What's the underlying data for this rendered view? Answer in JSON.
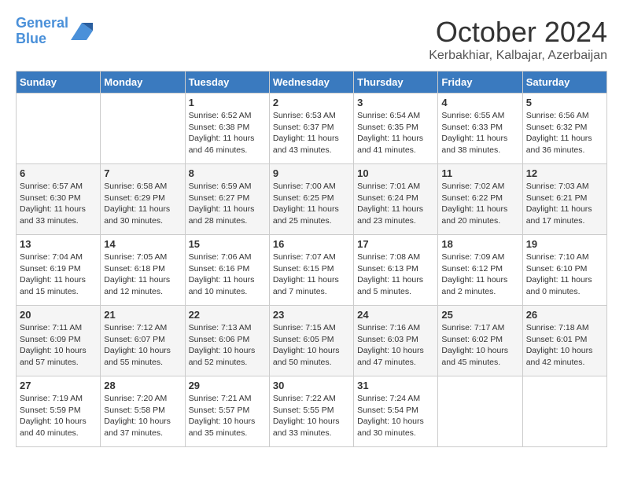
{
  "logo": {
    "line1": "General",
    "line2": "Blue"
  },
  "header": {
    "month": "October 2024",
    "location": "Kerbakhiar, Kalbajar, Azerbaijan"
  },
  "weekdays": [
    "Sunday",
    "Monday",
    "Tuesday",
    "Wednesday",
    "Thursday",
    "Friday",
    "Saturday"
  ],
  "weeks": [
    [
      {
        "day": "",
        "sunrise": "",
        "sunset": "",
        "daylight": ""
      },
      {
        "day": "",
        "sunrise": "",
        "sunset": "",
        "daylight": ""
      },
      {
        "day": "1",
        "sunrise": "Sunrise: 6:52 AM",
        "sunset": "Sunset: 6:38 PM",
        "daylight": "Daylight: 11 hours and 46 minutes."
      },
      {
        "day": "2",
        "sunrise": "Sunrise: 6:53 AM",
        "sunset": "Sunset: 6:37 PM",
        "daylight": "Daylight: 11 hours and 43 minutes."
      },
      {
        "day": "3",
        "sunrise": "Sunrise: 6:54 AM",
        "sunset": "Sunset: 6:35 PM",
        "daylight": "Daylight: 11 hours and 41 minutes."
      },
      {
        "day": "4",
        "sunrise": "Sunrise: 6:55 AM",
        "sunset": "Sunset: 6:33 PM",
        "daylight": "Daylight: 11 hours and 38 minutes."
      },
      {
        "day": "5",
        "sunrise": "Sunrise: 6:56 AM",
        "sunset": "Sunset: 6:32 PM",
        "daylight": "Daylight: 11 hours and 36 minutes."
      }
    ],
    [
      {
        "day": "6",
        "sunrise": "Sunrise: 6:57 AM",
        "sunset": "Sunset: 6:30 PM",
        "daylight": "Daylight: 11 hours and 33 minutes."
      },
      {
        "day": "7",
        "sunrise": "Sunrise: 6:58 AM",
        "sunset": "Sunset: 6:29 PM",
        "daylight": "Daylight: 11 hours and 30 minutes."
      },
      {
        "day": "8",
        "sunrise": "Sunrise: 6:59 AM",
        "sunset": "Sunset: 6:27 PM",
        "daylight": "Daylight: 11 hours and 28 minutes."
      },
      {
        "day": "9",
        "sunrise": "Sunrise: 7:00 AM",
        "sunset": "Sunset: 6:25 PM",
        "daylight": "Daylight: 11 hours and 25 minutes."
      },
      {
        "day": "10",
        "sunrise": "Sunrise: 7:01 AM",
        "sunset": "Sunset: 6:24 PM",
        "daylight": "Daylight: 11 hours and 23 minutes."
      },
      {
        "day": "11",
        "sunrise": "Sunrise: 7:02 AM",
        "sunset": "Sunset: 6:22 PM",
        "daylight": "Daylight: 11 hours and 20 minutes."
      },
      {
        "day": "12",
        "sunrise": "Sunrise: 7:03 AM",
        "sunset": "Sunset: 6:21 PM",
        "daylight": "Daylight: 11 hours and 17 minutes."
      }
    ],
    [
      {
        "day": "13",
        "sunrise": "Sunrise: 7:04 AM",
        "sunset": "Sunset: 6:19 PM",
        "daylight": "Daylight: 11 hours and 15 minutes."
      },
      {
        "day": "14",
        "sunrise": "Sunrise: 7:05 AM",
        "sunset": "Sunset: 6:18 PM",
        "daylight": "Daylight: 11 hours and 12 minutes."
      },
      {
        "day": "15",
        "sunrise": "Sunrise: 7:06 AM",
        "sunset": "Sunset: 6:16 PM",
        "daylight": "Daylight: 11 hours and 10 minutes."
      },
      {
        "day": "16",
        "sunrise": "Sunrise: 7:07 AM",
        "sunset": "Sunset: 6:15 PM",
        "daylight": "Daylight: 11 hours and 7 minutes."
      },
      {
        "day": "17",
        "sunrise": "Sunrise: 7:08 AM",
        "sunset": "Sunset: 6:13 PM",
        "daylight": "Daylight: 11 hours and 5 minutes."
      },
      {
        "day": "18",
        "sunrise": "Sunrise: 7:09 AM",
        "sunset": "Sunset: 6:12 PM",
        "daylight": "Daylight: 11 hours and 2 minutes."
      },
      {
        "day": "19",
        "sunrise": "Sunrise: 7:10 AM",
        "sunset": "Sunset: 6:10 PM",
        "daylight": "Daylight: 11 hours and 0 minutes."
      }
    ],
    [
      {
        "day": "20",
        "sunrise": "Sunrise: 7:11 AM",
        "sunset": "Sunset: 6:09 PM",
        "daylight": "Daylight: 10 hours and 57 minutes."
      },
      {
        "day": "21",
        "sunrise": "Sunrise: 7:12 AM",
        "sunset": "Sunset: 6:07 PM",
        "daylight": "Daylight: 10 hours and 55 minutes."
      },
      {
        "day": "22",
        "sunrise": "Sunrise: 7:13 AM",
        "sunset": "Sunset: 6:06 PM",
        "daylight": "Daylight: 10 hours and 52 minutes."
      },
      {
        "day": "23",
        "sunrise": "Sunrise: 7:15 AM",
        "sunset": "Sunset: 6:05 PM",
        "daylight": "Daylight: 10 hours and 50 minutes."
      },
      {
        "day": "24",
        "sunrise": "Sunrise: 7:16 AM",
        "sunset": "Sunset: 6:03 PM",
        "daylight": "Daylight: 10 hours and 47 minutes."
      },
      {
        "day": "25",
        "sunrise": "Sunrise: 7:17 AM",
        "sunset": "Sunset: 6:02 PM",
        "daylight": "Daylight: 10 hours and 45 minutes."
      },
      {
        "day": "26",
        "sunrise": "Sunrise: 7:18 AM",
        "sunset": "Sunset: 6:01 PM",
        "daylight": "Daylight: 10 hours and 42 minutes."
      }
    ],
    [
      {
        "day": "27",
        "sunrise": "Sunrise: 7:19 AM",
        "sunset": "Sunset: 5:59 PM",
        "daylight": "Daylight: 10 hours and 40 minutes."
      },
      {
        "day": "28",
        "sunrise": "Sunrise: 7:20 AM",
        "sunset": "Sunset: 5:58 PM",
        "daylight": "Daylight: 10 hours and 37 minutes."
      },
      {
        "day": "29",
        "sunrise": "Sunrise: 7:21 AM",
        "sunset": "Sunset: 5:57 PM",
        "daylight": "Daylight: 10 hours and 35 minutes."
      },
      {
        "day": "30",
        "sunrise": "Sunrise: 7:22 AM",
        "sunset": "Sunset: 5:55 PM",
        "daylight": "Daylight: 10 hours and 33 minutes."
      },
      {
        "day": "31",
        "sunrise": "Sunrise: 7:24 AM",
        "sunset": "Sunset: 5:54 PM",
        "daylight": "Daylight: 10 hours and 30 minutes."
      },
      {
        "day": "",
        "sunrise": "",
        "sunset": "",
        "daylight": ""
      },
      {
        "day": "",
        "sunrise": "",
        "sunset": "",
        "daylight": ""
      }
    ]
  ]
}
